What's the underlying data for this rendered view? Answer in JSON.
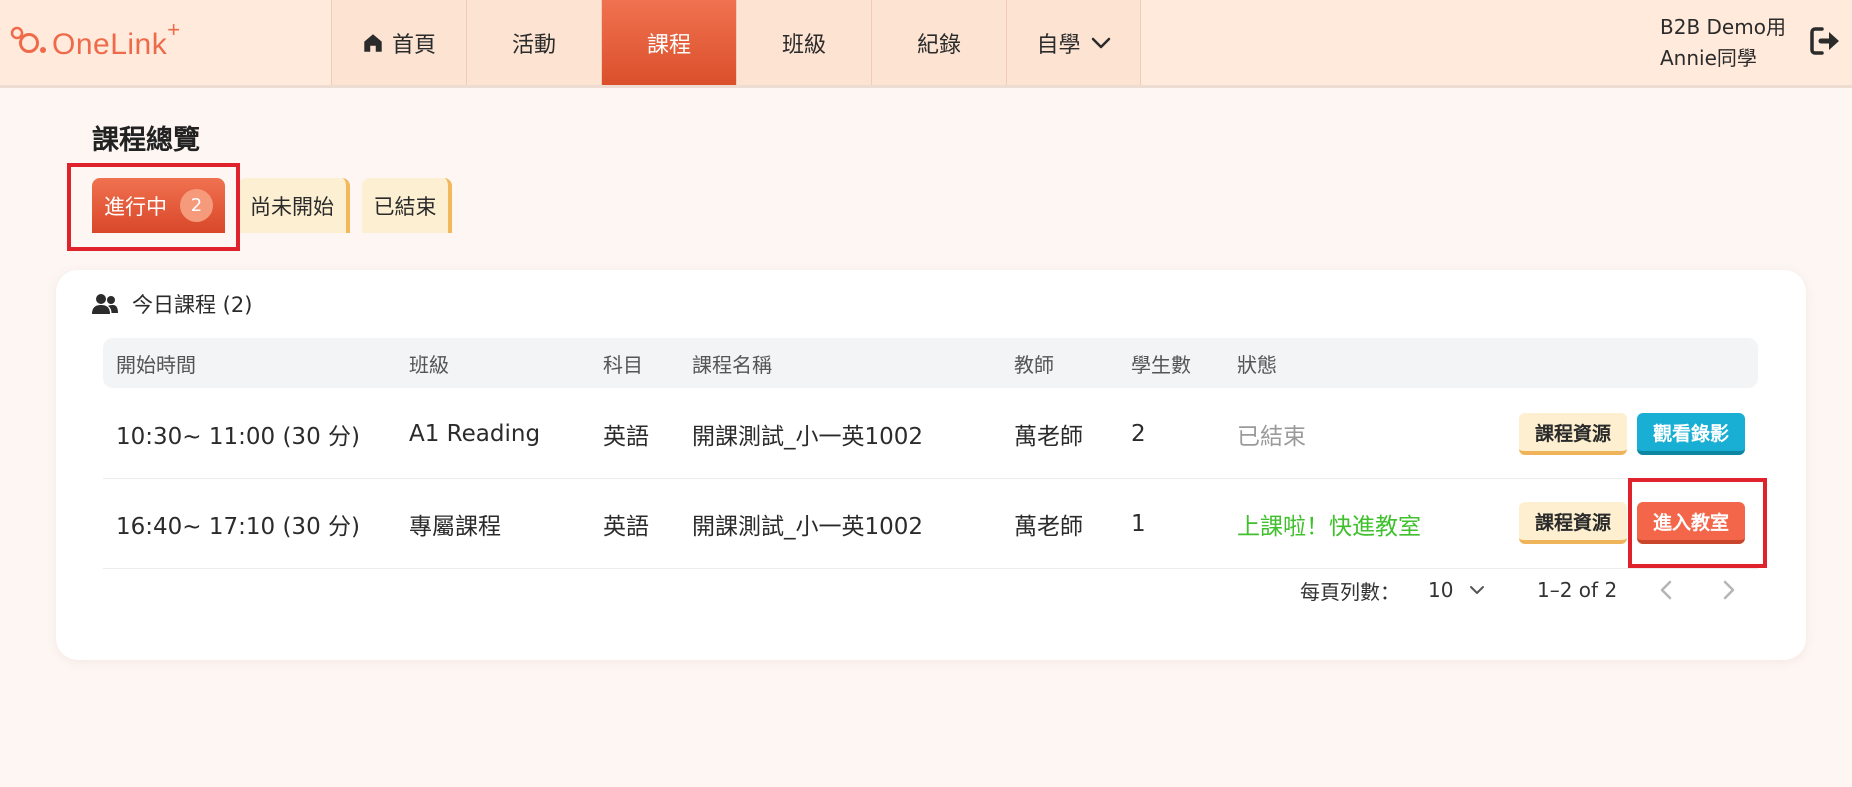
{
  "brand": {
    "name": "OneLink",
    "plus": "+",
    "color": "#ef6a4a"
  },
  "nav": {
    "items": [
      {
        "label": "首頁",
        "icon": "home-icon",
        "active": false
      },
      {
        "label": "活動",
        "active": false
      },
      {
        "label": "課程",
        "active": true
      },
      {
        "label": "班級",
        "active": false
      },
      {
        "label": "紀錄",
        "active": false
      },
      {
        "label": "自學",
        "icon": "chevron-down-icon",
        "active": false
      }
    ]
  },
  "user": {
    "line1": "B2B Demo用",
    "line2": "Annie同學",
    "logout_icon": "logout-icon"
  },
  "page": {
    "title": "課程總覽",
    "tabs": [
      {
        "label": "進行中",
        "count": "2",
        "active": true
      },
      {
        "label": "尚未開始",
        "active": false
      },
      {
        "label": "已結束",
        "active": false
      }
    ]
  },
  "card": {
    "title": "今日課程 (2)",
    "icon": "users-icon",
    "columns": [
      "開始時間",
      "班級",
      "科目",
      "課程名稱",
      "教師",
      "學生數",
      "狀態"
    ],
    "rows": [
      {
        "time": "10:30~ 11:00 (30 分)",
        "class": "A1 Reading",
        "subject": "英語",
        "course": "開課測試_小一英1002",
        "teacher": "萬老師",
        "students": "2",
        "status": "已結束",
        "btn_resource": "課程資源",
        "btn_action": "觀看錄影"
      },
      {
        "time": "16:40~ 17:10 (30 分)",
        "class": "專屬課程",
        "subject": "英語",
        "course": "開課測試_小一英1002",
        "teacher": "萬老師",
        "students": "1",
        "status": "上課啦！快進教室",
        "btn_resource": "課程資源",
        "btn_action": "進入教室"
      }
    ],
    "pager": {
      "rows_per_page_label": "每頁列數：",
      "rows_per_page": "10",
      "range": "1–2 of 2"
    }
  },
  "colors": {
    "accent": "#ef6a4a",
    "highlight_box": "#e0222d",
    "status_ended": "#9a9a9a",
    "status_live": "#3fc02c",
    "watch_button": "#19aed3"
  }
}
